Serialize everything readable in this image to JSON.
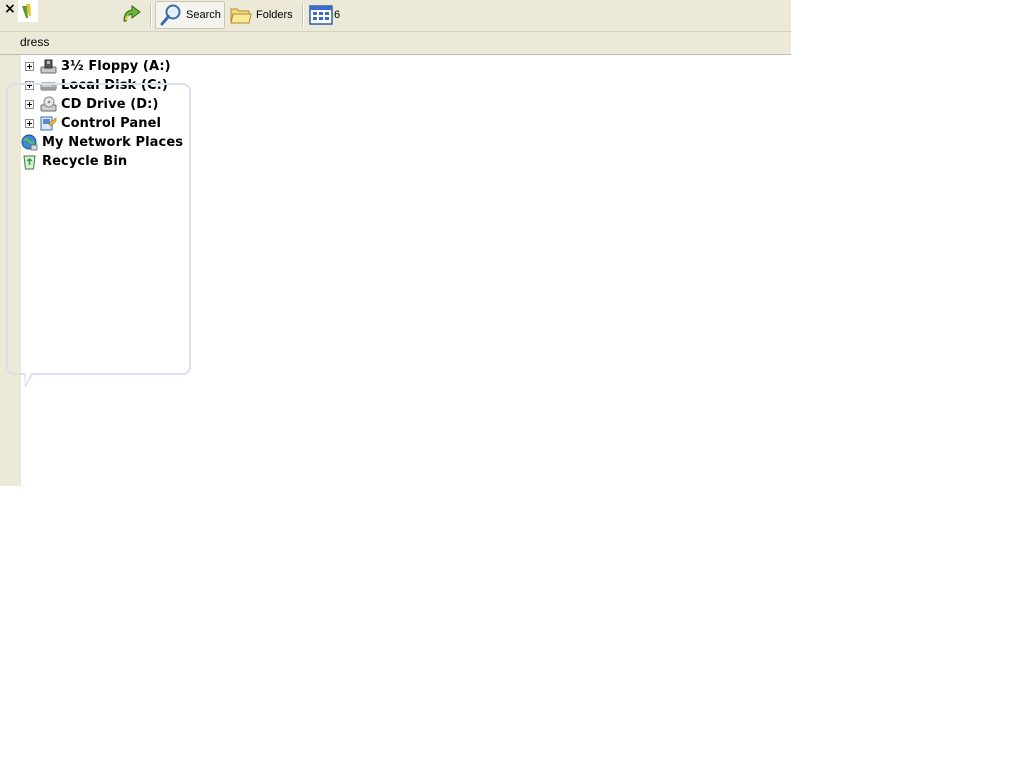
{
  "toolbar": {
    "close_glyph": "×",
    "search_label": "Search",
    "folders_label": "Folders",
    "views_suffix": "6"
  },
  "address": {
    "label": "dress"
  },
  "tree": {
    "items": [
      {
        "label": "3½ Floppy (A:)",
        "icon": "floppy-drive-icon",
        "expandable": true
      },
      {
        "label": "Local Disk (C:)",
        "icon": "hard-disk-icon",
        "expandable": true
      },
      {
        "label": "CD Drive (D:)",
        "icon": "cd-drive-icon",
        "expandable": true
      },
      {
        "label": "Control Panel",
        "icon": "control-panel-icon",
        "expandable": true
      },
      {
        "label": "My Network Places",
        "icon": "network-places-icon",
        "expandable": false
      },
      {
        "label": "Recycle Bin",
        "icon": "recycle-bin-icon",
        "expandable": false
      }
    ]
  },
  "colors": {
    "chrome": "#ece9d8",
    "balloon_border": "#dcdff0"
  }
}
